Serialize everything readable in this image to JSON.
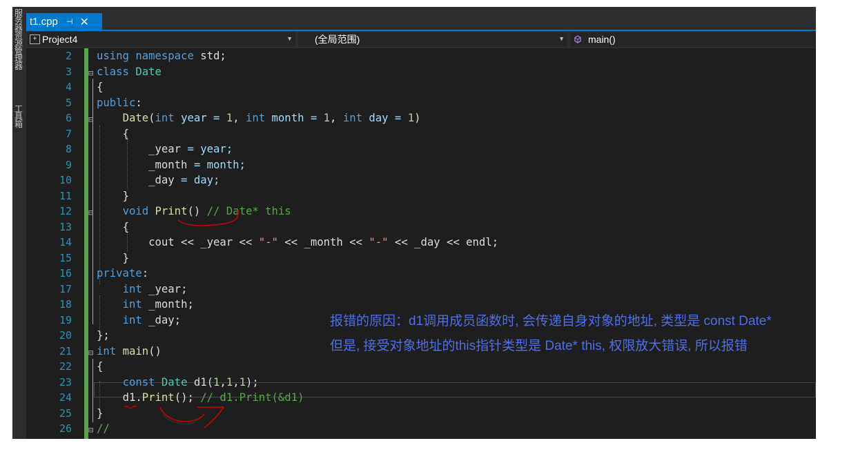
{
  "sidebar": {
    "label_top": "服务器资源管理器",
    "label_bottom": "工具箱"
  },
  "tab": {
    "title": "t1.cpp",
    "pin_glyph": "⊣",
    "close_glyph": "✕"
  },
  "navbar": {
    "project": "Project4",
    "scope": "(全局范围)",
    "member": "main()"
  },
  "line_numbers": [
    "2",
    "3",
    "4",
    "5",
    "6",
    "7",
    "8",
    "9",
    "10",
    "11",
    "12",
    "13",
    "14",
    "15",
    "16",
    "17",
    "18",
    "19",
    "20",
    "21",
    "22",
    "23",
    "24",
    "25",
    "26"
  ],
  "code": {
    "l2": {
      "a": "using",
      "b": " ",
      "c": "namespace",
      "d": " std;"
    },
    "l3": {
      "a": "class",
      "b": " ",
      "c": "Date"
    },
    "l4": {
      "a": "{"
    },
    "l5": {
      "a": "public",
      "b": ":"
    },
    "l6": {
      "a": "Date",
      "b": "(",
      "c": "int",
      "d": " year = ",
      "e": "1",
      "f": ", ",
      "g": "int",
      "h": " month = ",
      "i": "1",
      "j": ", ",
      "k": "int",
      "l": " day = ",
      "m": "1",
      "n": ")"
    },
    "l7": {
      "a": "{"
    },
    "l8": {
      "a": "_year",
      "b": " = year;"
    },
    "l9": {
      "a": "_month",
      "b": " = month;"
    },
    "l10": {
      "a": "_day",
      "b": " = day;"
    },
    "l11": {
      "a": "}"
    },
    "l12": {
      "a": "void",
      "b": " ",
      "c": "Print",
      "d": "() ",
      "e": "// Date* this"
    },
    "l13": {
      "a": "{"
    },
    "l14": {
      "a": "cout << _year << ",
      "b": "\"-\"",
      "c": " << _month << ",
      "d": "\"-\"",
      "e": " << _day << endl;"
    },
    "l15": {
      "a": "}"
    },
    "l16": {
      "a": "private",
      "b": ":"
    },
    "l17": {
      "a": "int",
      "b": " _year;"
    },
    "l18": {
      "a": "int",
      "b": " _month;"
    },
    "l19": {
      "a": "int",
      "b": " _day;"
    },
    "l20": {
      "a": "};"
    },
    "l21": {
      "a": "int",
      "b": " ",
      "c": "main",
      "d": "()"
    },
    "l22": {
      "a": "{"
    },
    "l23": {
      "a": "const",
      "b": " ",
      "c": "Date",
      "d": " d1(",
      "e": "1",
      "f": ",",
      "g": "1",
      "h": ",",
      "i": "1",
      "j": ");"
    },
    "l24": {
      "a": "d1",
      "b": ".",
      "c": "Print",
      "d": "(); ",
      "e": "// d1.Print(&d1)"
    },
    "l25": {
      "a": "}"
    },
    "l26": {
      "a": "//"
    }
  },
  "notes": {
    "line1": "报错的原因：d1调用成员函数时, 会传递自身对象的地址, 类型是 const Date*",
    "line2": "但是, 接受对象地址的this指针类型是 Date* this, 权限放大错误, 所以报错"
  },
  "colors": {
    "editor_bg": "#1e1e1e",
    "tab_accent": "#007acc",
    "keyword": "#569cd6",
    "type": "#4ec9b0",
    "function": "#dcdcaa",
    "comment": "#57a64a",
    "annotation_text": "#4f6de6",
    "annotation_ink": "#e00000"
  }
}
